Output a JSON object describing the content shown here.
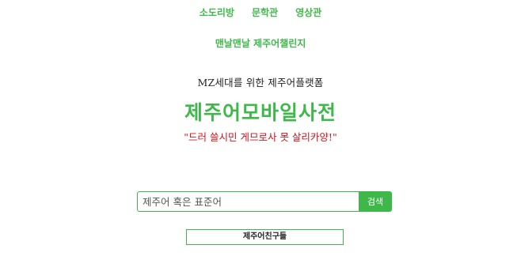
{
  "nav": {
    "items": [
      {
        "label": "소도리방"
      },
      {
        "label": "문학관"
      },
      {
        "label": "영상관"
      }
    ],
    "sub_link": "맨날맨날 제주어챌린지"
  },
  "hero": {
    "tagline": "MZ세대를 위한 제주어플랫폼",
    "title": "제주어모바일사전",
    "slogan": "\"드러 쓸시민 게므로사 못 살리카양!\""
  },
  "search": {
    "placeholder": "제주어 혹은 표준어",
    "button_label": "검색"
  },
  "friends_button_label": "제주어친구들",
  "colors": {
    "accent": "#3fb84a",
    "slogan": "#d9101a"
  }
}
